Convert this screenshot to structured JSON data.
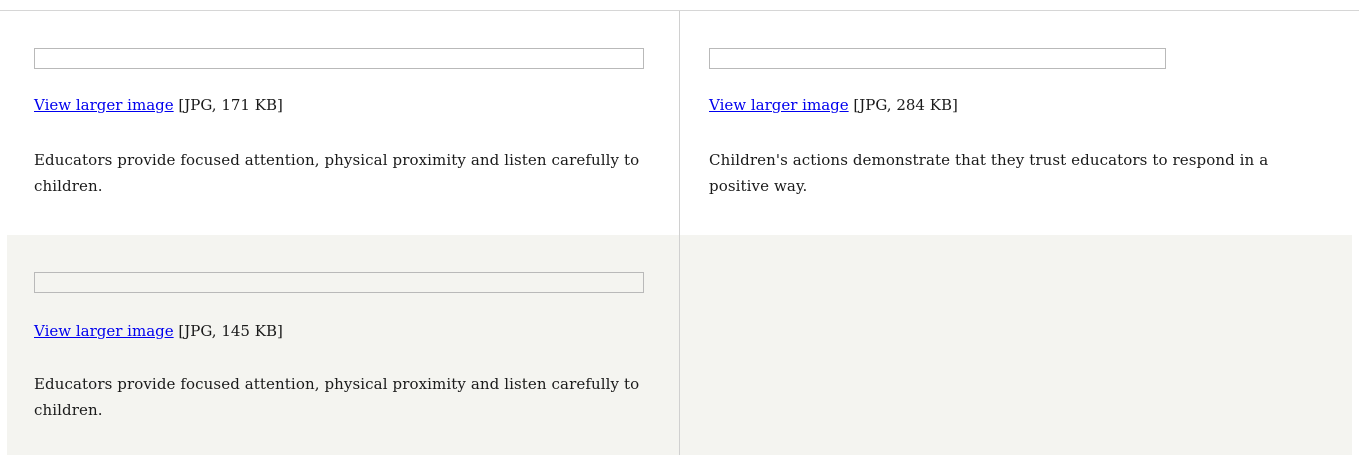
{
  "items": [
    {
      "link_label": "View larger image",
      "file_info": "[JPG, 171 KB]",
      "caption": "Educators provide focused attention, physical proximity and listen carefully to children."
    },
    {
      "link_label": "View larger image",
      "file_info": "[JPG, 284 KB]",
      "caption": "Children's actions demonstrate that they trust educators to respond in a positive way."
    },
    {
      "link_label": "View larger image",
      "file_info": "[JPG, 145 KB]",
      "caption": "Educators provide focused attention, physical proximity and listen carefully to children."
    }
  ],
  "colors": {
    "link": "#0000ee",
    "alt_row_background": "#f4f4f0",
    "divider": "#d0d0d0"
  }
}
